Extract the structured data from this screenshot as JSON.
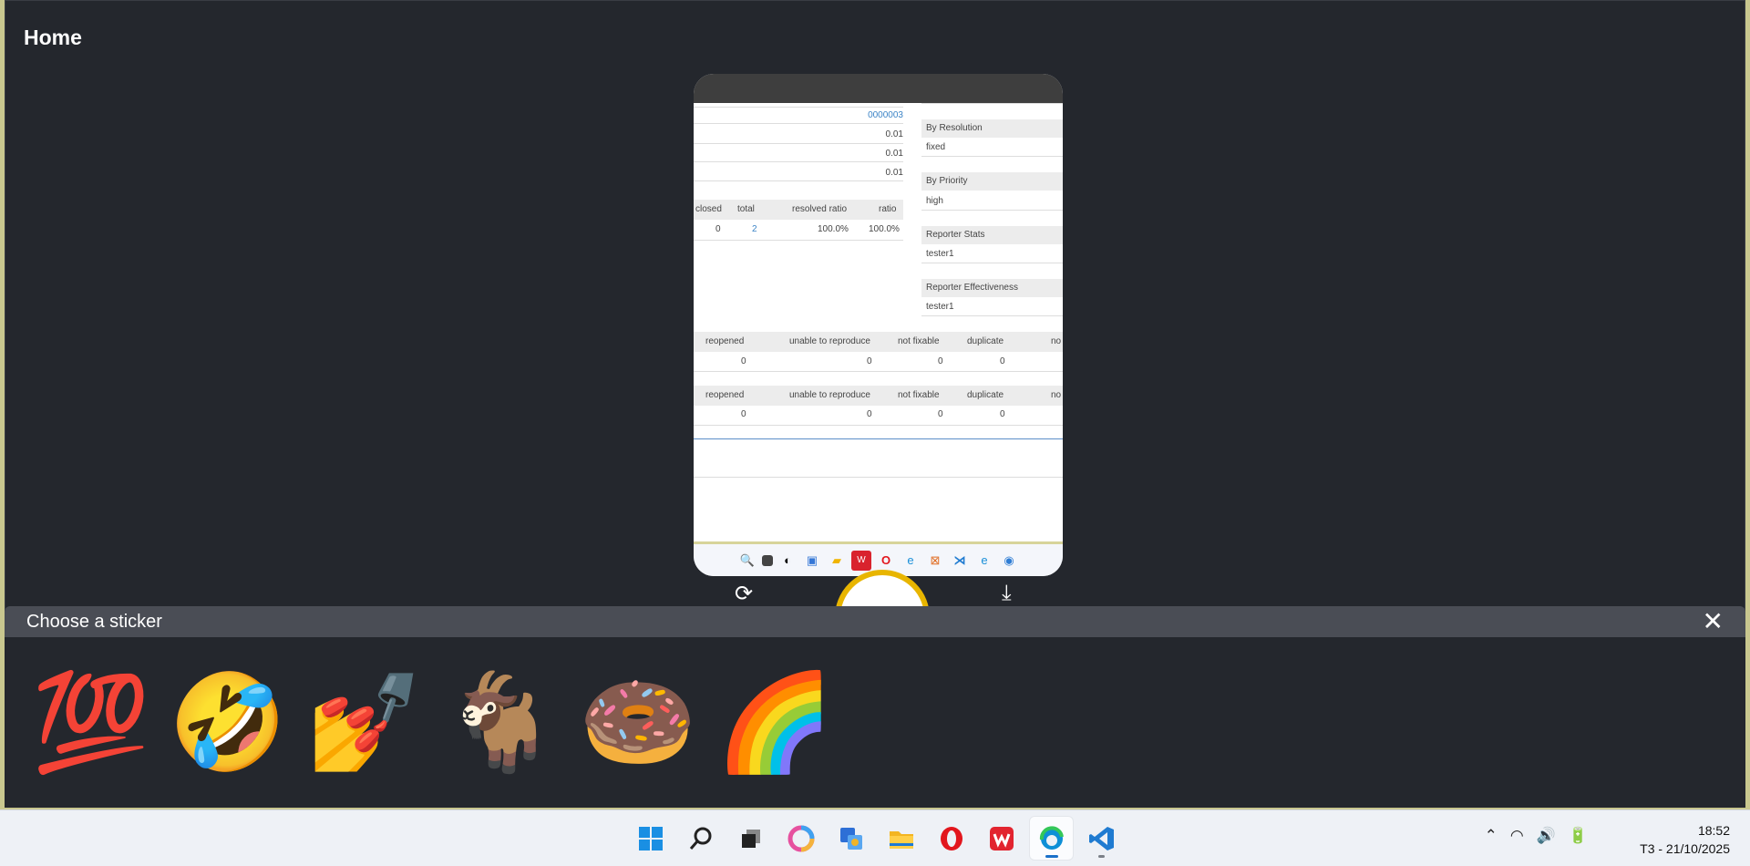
{
  "home_title": "Home",
  "preview": {
    "ref_id": "0000003",
    "values": [
      "0.01",
      "0.01",
      "0.01"
    ],
    "table1_headers": [
      "closed",
      "total",
      "resolved ratio",
      "ratio"
    ],
    "table1_row": [
      "0",
      "2",
      "100.0%",
      "100.0%"
    ],
    "side_sections": [
      {
        "title": "By Resolution",
        "value": "fixed"
      },
      {
        "title": "By Priority",
        "value": "high"
      },
      {
        "title": "Reporter Stats",
        "value": "tester1"
      },
      {
        "title": "Reporter Effectiveness",
        "value": "tester1"
      }
    ],
    "table2_headers": [
      "reopened",
      "unable to reproduce",
      "not fixable",
      "duplicate",
      "no"
    ],
    "table2_row": [
      "0",
      "0",
      "0",
      "0"
    ],
    "table3_headers": [
      "reopened",
      "unable to reproduce",
      "not fixable",
      "duplicate",
      "no"
    ],
    "table3_row": [
      "0",
      "0",
      "0",
      "0"
    ]
  },
  "sticker_panel": {
    "title": "Choose a sticker",
    "close_icon": "✕",
    "stickers": [
      "💯",
      "🤣",
      "💅",
      "🐐",
      "🍩",
      "🌈"
    ]
  },
  "actions": {
    "refresh_icon": "⟳",
    "download_icon": "⤓"
  },
  "taskbar": {
    "apps": [
      "windows-start",
      "search",
      "task-view",
      "copilot",
      "phone-link",
      "file-explorer",
      "opera",
      "wps-office",
      "edge",
      "vscode"
    ],
    "time": "18:52",
    "date": "T3 - 21/10/2025"
  },
  "colors": {
    "app_bg": "#24272d",
    "accent": "#e8b500",
    "outer_border": "#c9c78f"
  }
}
